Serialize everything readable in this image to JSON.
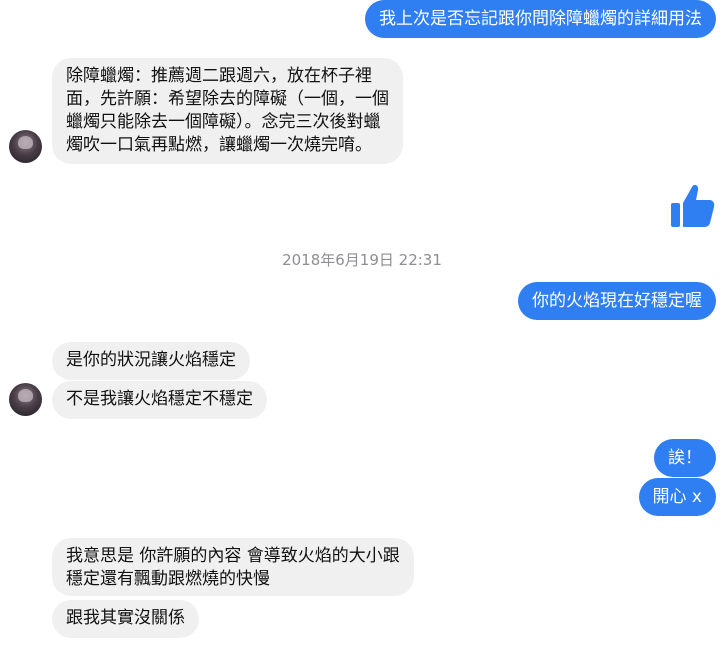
{
  "messages": {
    "m1": "我上次是否忘記跟你問除障蠟燭的詳細用法",
    "m2": "除障蠟燭：推薦週二跟週六，放在杯子裡\n面，先許願：希望除去的障礙（一個，一個\n蠟燭只能除去一個障礙）。念完三次後對蠟\n燭吹一口氣再點燃，讓蠟燭一次燒完唷。",
    "m3": "你的火焰現在好穩定喔",
    "m4": "是你的狀況讓火焰穩定",
    "m5": "不是我讓火焰穩定不穩定",
    "m6": "誒！",
    "m7": "開心 x",
    "m8": "我意思是 你許願的內容 會導致火焰的大小跟\n穩定還有飄動跟燃燒的快慢",
    "m9": "跟我其實沒關係"
  },
  "timestamp": "2018年6月19日 22:31",
  "icons": {
    "like": "thumbs-up-icon",
    "avatar": "contact-avatar"
  },
  "colors": {
    "outgoing": "#2f7ff2",
    "incoming": "#f1f0f0"
  }
}
